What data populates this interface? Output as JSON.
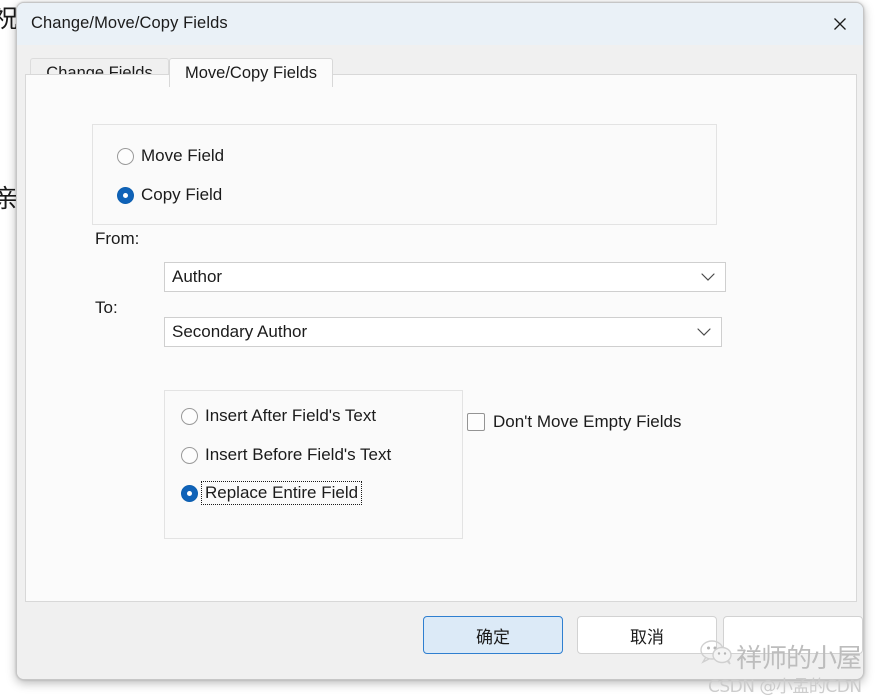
{
  "background": {
    "char_top": "祝",
    "char_mid": "亲"
  },
  "window": {
    "title": "Change/Move/Copy Fields",
    "close_icon": "close-icon"
  },
  "tabs": [
    {
      "label": "Change Fields",
      "active": false
    },
    {
      "label": "Move/Copy Fields",
      "active": true
    }
  ],
  "operation_group": {
    "options": [
      {
        "label": "Move Field",
        "selected": false
      },
      {
        "label": "Copy Field",
        "selected": true
      }
    ]
  },
  "from_field": {
    "label": "From:",
    "value": "Author",
    "arrow_icon": "chevron-down-icon"
  },
  "to_field": {
    "label": "To:",
    "value": "Secondary Author",
    "arrow_icon": "chevron-down-icon"
  },
  "insert_group": {
    "options": [
      {
        "label": "Insert After Field's Text",
        "selected": false
      },
      {
        "label": "Insert Before Field's Text",
        "selected": false
      },
      {
        "label": "Replace Entire Field",
        "selected": true,
        "focused": true
      }
    ]
  },
  "dont_move_empty": {
    "label": "Don't Move Empty Fields",
    "checked": false
  },
  "footer": {
    "ok_label": "确定",
    "cancel_label": "取消",
    "extra_label": ""
  },
  "watermark": {
    "brand": "祥师的小屋",
    "credit": "CSDN @小孟的CDN",
    "icon": "wechat-icon"
  },
  "colors": {
    "accent": "#0f62b8",
    "titlebar": "#eaf1f7",
    "dialog_bg": "#f0f0f0",
    "panel_bg": "#fbfbfb",
    "ok_button_border": "#2f7fd0",
    "ok_button_fill": "#dceaf7"
  }
}
